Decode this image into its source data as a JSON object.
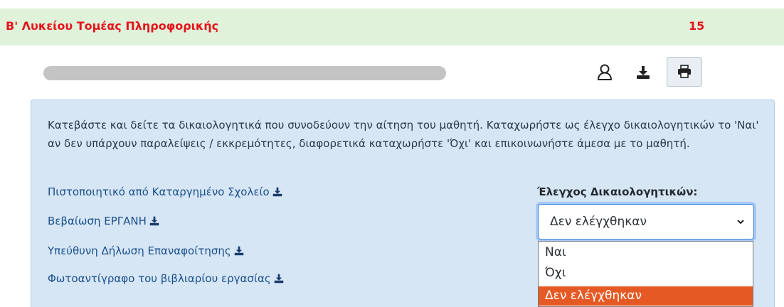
{
  "header": {
    "title": "Β' Λυκείου Τομέας Πληροφορικής",
    "count": "15"
  },
  "toolbar": {
    "user_icon": "user-icon",
    "download_icon": "download-icon",
    "print_icon": "print-icon"
  },
  "panel": {
    "instructions": "Κατεβάστε και δείτε τα δικαιολογητικά που συνοδεύουν την αίτηση του μαθητή. Καταχωρήστε ως έλεγχο δικαιολογητικών το 'Ναι' αν δεν υπάρχουν παραλείψεις / εκκρεμότητες, διαφορετικά καταχωρήστε 'Όχι' και επικοινωνήστε άμεσα με το μαθητή.",
    "documents": [
      "Πιστοποιητικό από Καταργημένο Σχολείο",
      "Βεβαίωση ΕΡΓΑΝΗ",
      "Υπεύθυνη Δήλωση Επαναφοίτησης",
      "Φωτοαντίγραφο του βιβλιαρίου εργασίας"
    ],
    "check_label": "Έλεγχος Δικαιολογητικών:",
    "select_value": "Δεν ελέγχθηκαν",
    "options": [
      "Ναι",
      "Όχι",
      "Δεν ελέγχθηκαν"
    ]
  },
  "colors": {
    "header_bg": "#e1f2db",
    "header_text": "#e4141b",
    "panel_bg": "#d6e6f5",
    "link": "#1a4f8c",
    "selected_option": "#e55a24"
  }
}
